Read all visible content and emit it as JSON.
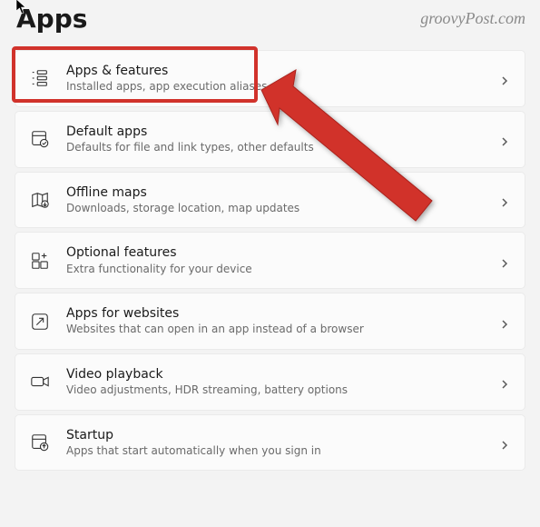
{
  "page": {
    "title": "Apps",
    "watermark": "groovyPost.com"
  },
  "rows": [
    {
      "icon": "apps-features",
      "title": "Apps & features",
      "subtitle": "Installed apps, app execution aliases"
    },
    {
      "icon": "default-apps",
      "title": "Default apps",
      "subtitle": "Defaults for file and link types, other defaults"
    },
    {
      "icon": "offline-maps",
      "title": "Offline maps",
      "subtitle": "Downloads, storage location, map updates"
    },
    {
      "icon": "optional",
      "title": "Optional features",
      "subtitle": "Extra functionality for your device"
    },
    {
      "icon": "websites",
      "title": "Apps for websites",
      "subtitle": "Websites that can open in an app instead of a browser"
    },
    {
      "icon": "video",
      "title": "Video playback",
      "subtitle": "Video adjustments, HDR streaming, battery options"
    },
    {
      "icon": "startup",
      "title": "Startup",
      "subtitle": "Apps that start automatically when you sign in"
    }
  ]
}
